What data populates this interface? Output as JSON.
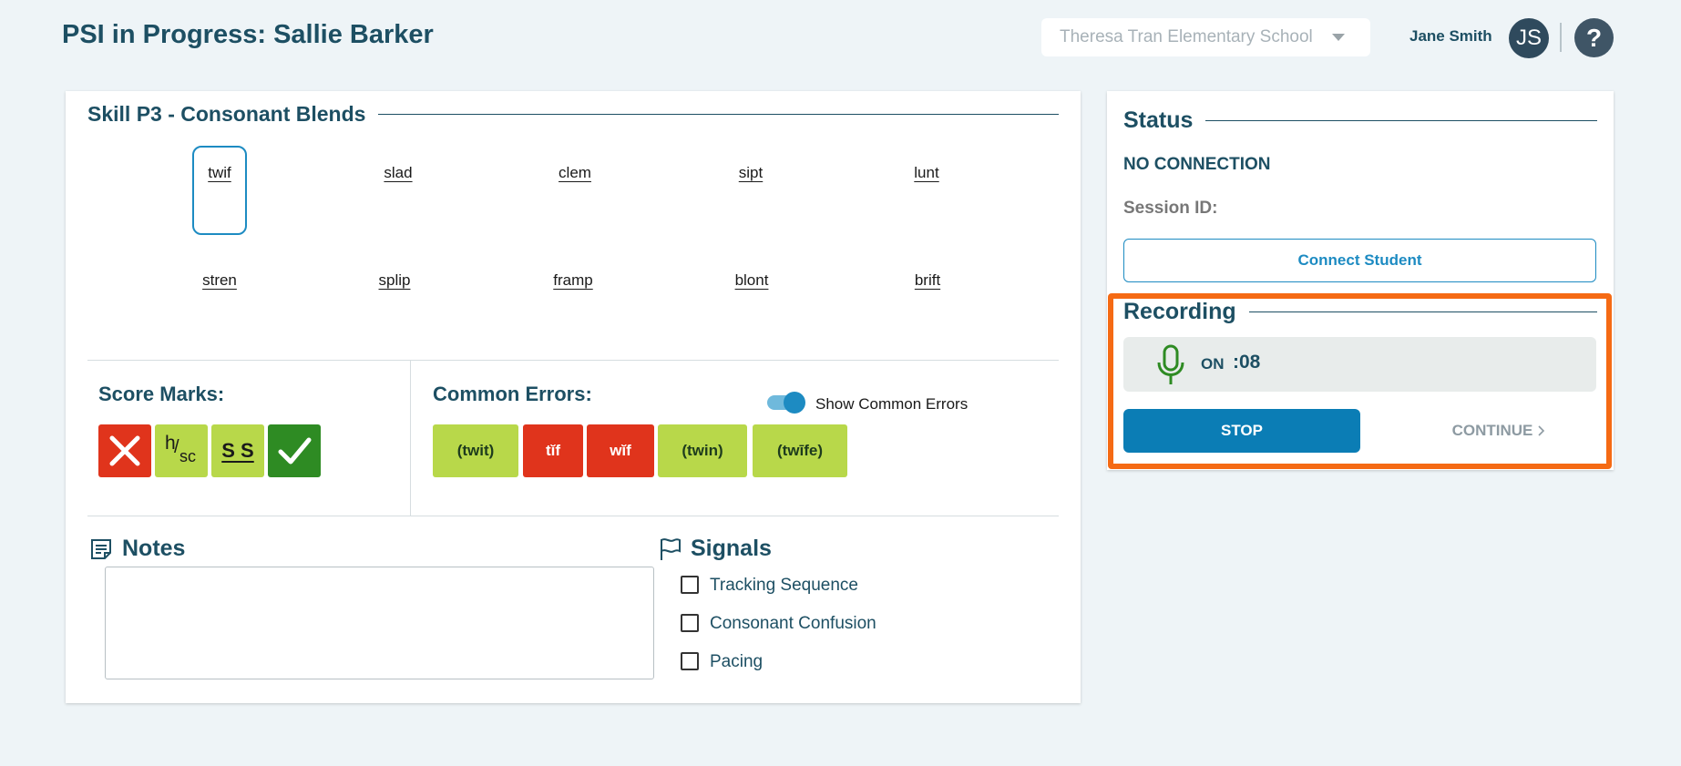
{
  "header": {
    "title": "PSI in Progress: Sallie Barker",
    "school_select": "Theresa Tran Elementary School",
    "user_name": "Jane Smith",
    "avatar_initials": "JS",
    "help_label": "?"
  },
  "skill": {
    "title": "Skill P3 - Consonant Blends",
    "words": [
      "twif",
      "slad",
      "clem",
      "sipt",
      "lunt",
      "stren",
      "splip",
      "framp",
      "blont",
      "brift"
    ]
  },
  "score_marks": {
    "title": "Score Marks:",
    "items": [
      {
        "name": "incorrect",
        "icon": "x-icon",
        "color": "#e0341c"
      },
      {
        "name": "hesitation-self-correct",
        "label_h": "h",
        "label_sc": "sc",
        "color": "#b8d84a"
      },
      {
        "name": "sound-by-sound",
        "label": "S S",
        "color": "#b8d84a"
      },
      {
        "name": "correct",
        "icon": "check-icon",
        "color": "#2e8b23"
      }
    ]
  },
  "common_errors": {
    "title": "Common Errors:",
    "toggle_label": "Show Common Errors",
    "toggle_on": true,
    "items": [
      {
        "label": "(twit)",
        "color": "#b8d84a"
      },
      {
        "label": "tĭf",
        "color": "#e0341c"
      },
      {
        "label": "wĭf",
        "color": "#e0341c"
      },
      {
        "label": "(twin)",
        "color": "#b8d84a"
      },
      {
        "label": "(twīfe)",
        "color": "#b8d84a"
      }
    ]
  },
  "notes": {
    "title": "Notes",
    "value": ""
  },
  "signals": {
    "title": "Signals",
    "items": [
      "Tracking Sequence",
      "Consonant Confusion",
      "Pacing"
    ]
  },
  "status": {
    "title": "Status",
    "connection": "NO CONNECTION",
    "session_label": "Session ID:",
    "connect_button": "Connect Student"
  },
  "recording": {
    "title": "Recording",
    "state": "ON",
    "time": ":08",
    "stop_button": "STOP",
    "continue_button": "CONTINUE"
  }
}
